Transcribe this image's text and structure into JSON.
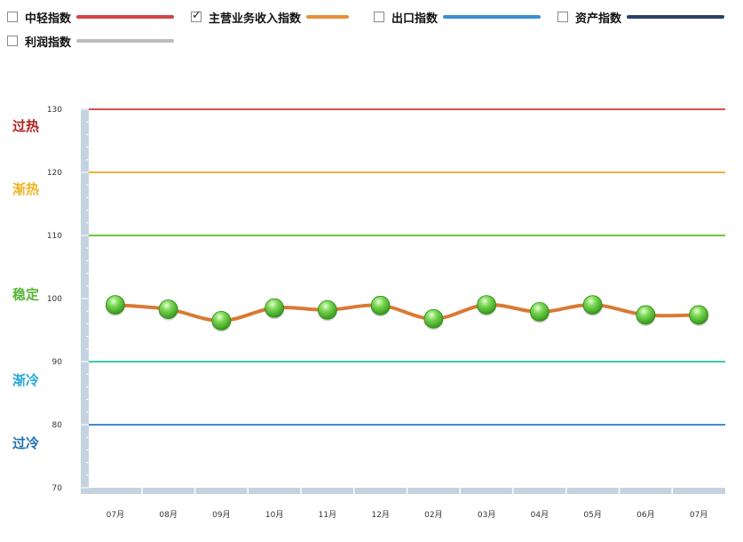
{
  "legend": {
    "items": [
      {
        "label": "中轻指数",
        "checked": false,
        "color": "#d04548"
      },
      {
        "label": "主营业务收入指数",
        "checked": true,
        "color": "#e8913a"
      },
      {
        "label": "出口指数",
        "checked": false,
        "color": "#3a8fd0"
      },
      {
        "label": "资产指数",
        "checked": false,
        "color": "#2b3f6a"
      },
      {
        "label": "利润指数",
        "checked": false,
        "color": "#bdbdbd"
      }
    ]
  },
  "chart_data": {
    "type": "line",
    "x": [
      "07月",
      "08月",
      "09月",
      "10月",
      "11月",
      "12月",
      "02月",
      "03月",
      "04月",
      "05月",
      "06月",
      "07月"
    ],
    "series": [
      {
        "name": "主营业务收入指数",
        "values": [
          99.0,
          98.3,
          96.5,
          98.5,
          98.2,
          98.9,
          96.8,
          99.0,
          97.9,
          99.0,
          97.4,
          97.4
        ],
        "color": "#d97a35",
        "marker_color": "#3cae1f"
      }
    ],
    "ylim": [
      70,
      130
    ],
    "yticks": [
      70,
      80,
      90,
      100,
      110,
      120,
      130
    ],
    "thresholds": [
      {
        "value": 130,
        "color": "#d85050"
      },
      {
        "value": 120,
        "color": "#f0b040"
      },
      {
        "value": 110,
        "color": "#6cc83c"
      },
      {
        "value": 90,
        "color": "#3cc8b0"
      },
      {
        "value": 80,
        "color": "#3c8cd0"
      }
    ],
    "zones": [
      {
        "label": "过热",
        "color": "#b22222",
        "at": 127.5
      },
      {
        "label": "渐热",
        "color": "#f0b420",
        "at": 117.5
      },
      {
        "label": "稳定",
        "color": "#55b534",
        "at": 100.8
      },
      {
        "label": "渐冷",
        "color": "#25a8d8",
        "at": 87.2
      },
      {
        "label": "过冷",
        "color": "#1e6fb0",
        "at": 77.2
      }
    ],
    "axis_color": "#c5d3e0"
  }
}
